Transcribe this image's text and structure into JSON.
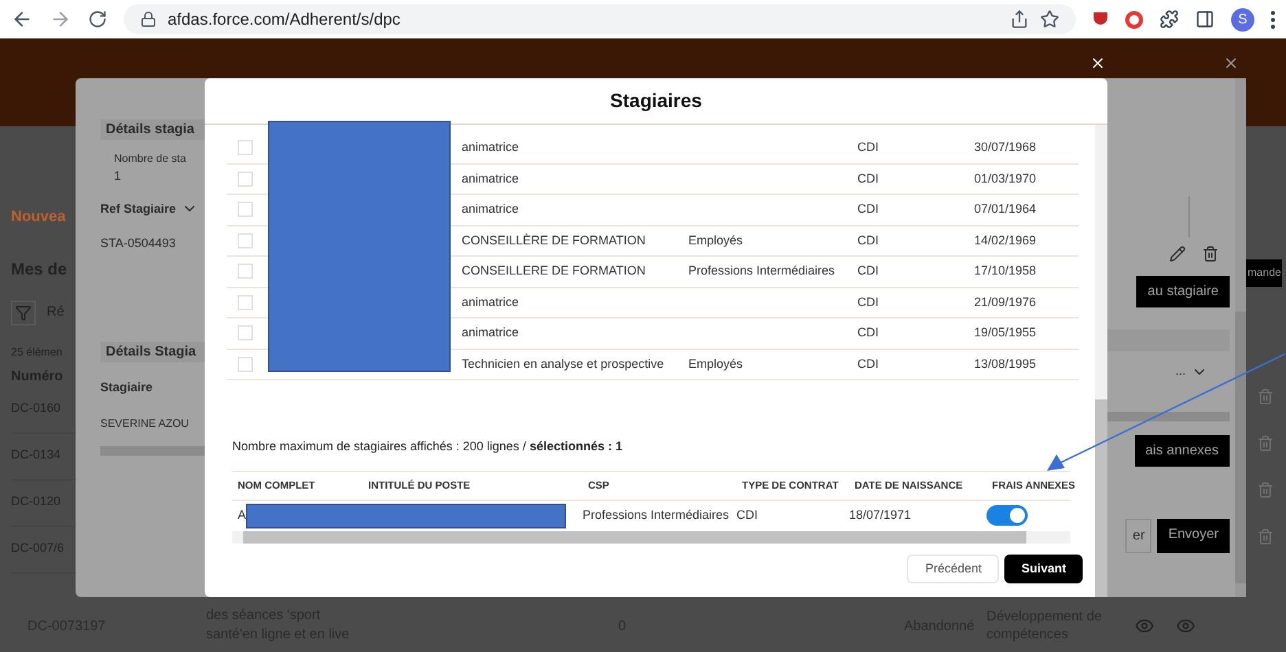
{
  "browser": {
    "url": "afdas.force.com/Adherent/s/dpc",
    "profile_initial": "S"
  },
  "background_page": {
    "new_link": "Nouvea",
    "section_title": "Mes de",
    "filter_label": "Ré",
    "count": "25 élémen",
    "column": "Numéro",
    "request_button": "mande",
    "rows": [
      "DC-0160",
      "DC-0134",
      "DC-0120",
      "DC-007/6"
    ],
    "last_row": {
      "number": "DC-0073197",
      "title_lines": [
        "des séances 'sport",
        "santé'en ligne et en live"
      ],
      "count": "0",
      "status": "Abandonné",
      "type_lines": [
        "Développement de",
        "compétences"
      ]
    }
  },
  "details_modal": {
    "section_title": "Détails stagia",
    "count_label": "Nombre de sta",
    "count_value": "1",
    "ref_column": "Ref Stagiaire",
    "ref_value": "STA-0504493",
    "section2_title": "Détails Stagia",
    "trainee_column": "Stagiaire",
    "trainee_value": "SEVERINE AZOU",
    "add_button": "au stagiaire",
    "dropdown": "...",
    "fees_button": "ais annexes",
    "back_button": "er",
    "send_button": "Envoyer"
  },
  "stagiaires_modal": {
    "title": "Stagiaires",
    "rows": [
      {
        "selected": false,
        "poste": "animatrice",
        "csp": "",
        "contrat": "CDI",
        "naissance": "30/07/1968"
      },
      {
        "selected": false,
        "poste": "animatrice",
        "csp": "",
        "contrat": "CDI",
        "naissance": "01/03/1970"
      },
      {
        "selected": false,
        "poste": "animatrice",
        "csp": "",
        "contrat": "CDI",
        "naissance": "07/01/1964"
      },
      {
        "selected": false,
        "poste": "CONSEILLÈRE DE FORMATION",
        "csp": "Employés",
        "contrat": "CDI",
        "naissance": "14/02/1969"
      },
      {
        "selected": false,
        "poste": "CONSEILLERE DE FORMATION",
        "csp": "Professions Intermédiaires",
        "contrat": "CDI",
        "naissance": "17/10/1958"
      },
      {
        "selected": false,
        "poste": "animatrice",
        "csp": "",
        "contrat": "CDI",
        "naissance": "21/09/1976"
      },
      {
        "selected": false,
        "poste": "animatrice",
        "csp": "",
        "contrat": "CDI",
        "naissance": "19/05/1955"
      },
      {
        "selected": false,
        "poste": "Technicien en analyse et prospective",
        "csp": "Employés",
        "contrat": "CDI",
        "naissance": "13/08/1995"
      }
    ],
    "summary": "Nombre maximum de stagiaires affichés : 200 lignes / **sélectionnés : 1**",
    "columns": [
      "NOM COMPLET",
      "INTITULÉ DU POSTE",
      "CSP",
      "TYPE DE CONTRAT",
      "DATE DE NAISSANCE",
      "FRAIS ANNEXES"
    ],
    "selected_rows": [
      {
        "name": "A",
        "csp": "Professions Intermédiaires",
        "contrat": "CDI",
        "naissance": "18/07/1971",
        "frais_annexes": true
      }
    ],
    "buttons": [
      "Précédent",
      "Suivant"
    ]
  }
}
